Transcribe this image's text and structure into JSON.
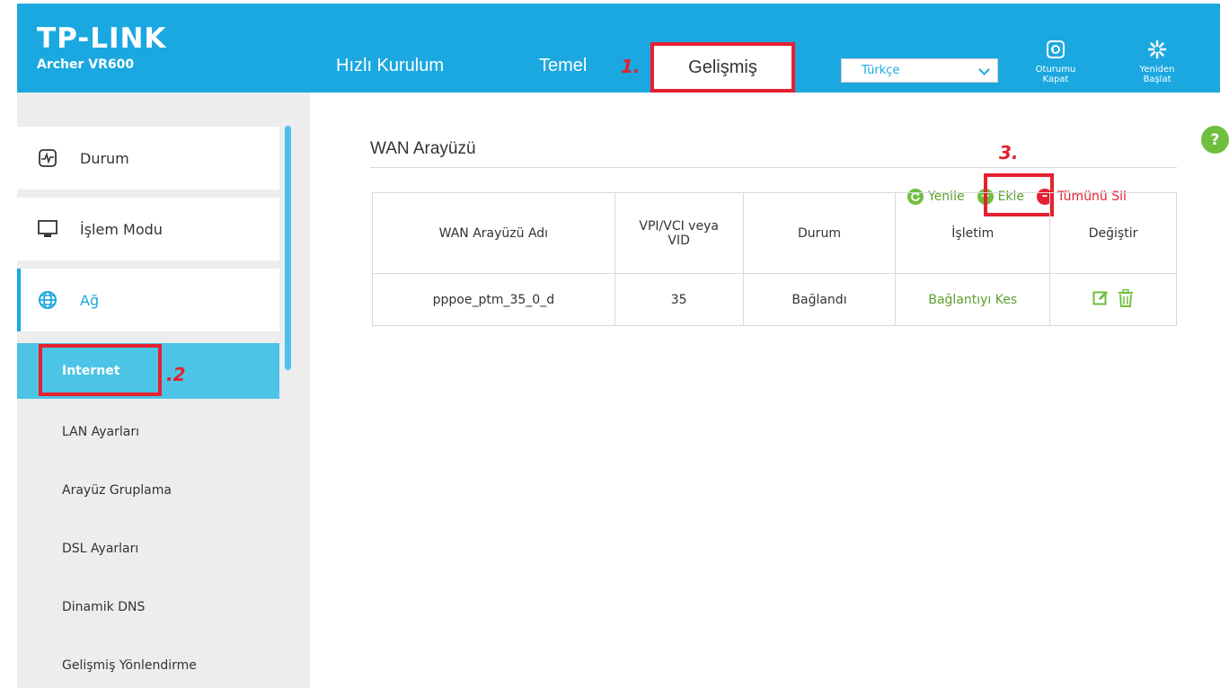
{
  "header": {
    "logo": "TP-LINK",
    "model": "Archer VR600",
    "nav": {
      "quick_setup": "Hızlı Kurulum",
      "basic": "Temel",
      "advanced": "Gelişmiş"
    },
    "language": "Türkçe",
    "logout_label": "Oturumu Kapat",
    "reboot_label": "Yeniden Başlat"
  },
  "annotations": {
    "step1": "1.",
    "step2": ".2",
    "step3": "3."
  },
  "sidebar": {
    "menu": [
      {
        "label": "Durum",
        "icon": "status-icon"
      },
      {
        "label": "İşlem Modu",
        "icon": "monitor-icon"
      },
      {
        "label": "Ağ",
        "icon": "globe-icon"
      }
    ],
    "submenu": [
      {
        "label": "Internet"
      },
      {
        "label": "LAN Ayarları"
      },
      {
        "label": "Arayüz Gruplama"
      },
      {
        "label": "DSL Ayarları"
      },
      {
        "label": "Dinamik DNS"
      },
      {
        "label": "Gelişmiş Yönlendirme"
      }
    ]
  },
  "main": {
    "title": "WAN Arayüzü",
    "actions": {
      "refresh": "Yenile",
      "add": "Ekle",
      "delete_all": "Tümünü Sil"
    },
    "table": {
      "columns": [
        "WAN Arayüzü Adı",
        "VPI/VCI veya VID",
        "Durum",
        "İşletim",
        "Değiştir"
      ],
      "rows": [
        {
          "name": "pppoe_ptm_35_0_d",
          "vid": "35",
          "status": "Bağlandı",
          "operation": "Bağlantıyı Kes"
        }
      ]
    }
  },
  "help": "?",
  "colors": {
    "brand": "#1ba8e0",
    "annotation": "#e5202f",
    "green": "#5aa02c",
    "red": "#e5202f"
  }
}
